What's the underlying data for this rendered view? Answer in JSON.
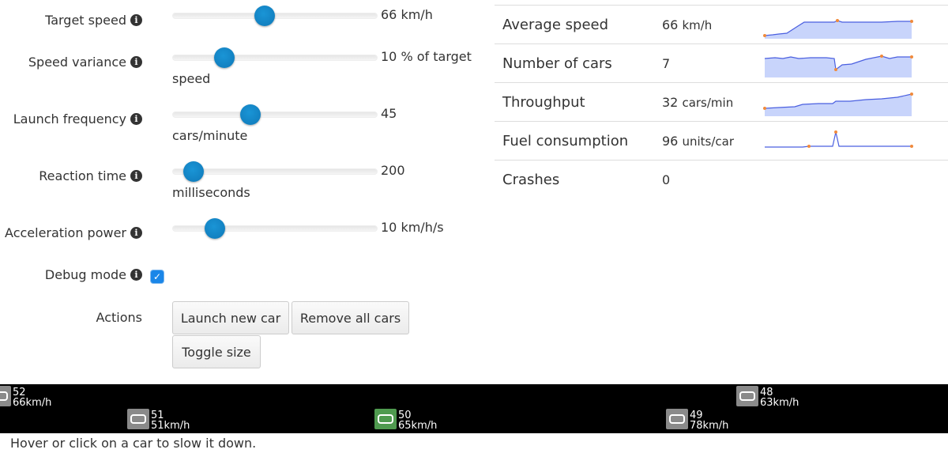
{
  "controls": {
    "target_speed": {
      "label": "Target speed",
      "value": "66 km/h",
      "level": 0.45
    },
    "speed_variance": {
      "label": "Speed variance",
      "value": "10 % of target",
      "unit": "speed",
      "level": 0.25
    },
    "launch_frequency": {
      "label": "Launch frequency",
      "value": "45",
      "unit": "cars/minute",
      "level": 0.38
    },
    "reaction_time": {
      "label": "Reaction time",
      "value": "200",
      "unit": "milliseconds",
      "level": 0.1
    },
    "acceleration_power": {
      "label": "Acceleration power",
      "value": "10 km/h/s",
      "level": 0.2
    },
    "debug_mode": {
      "label": "Debug mode",
      "checked": true
    },
    "actions": {
      "label": "Actions"
    }
  },
  "buttons": {
    "launch": "Launch new car",
    "remove": "Remove all cars",
    "toggle": "Toggle size"
  },
  "stats": [
    {
      "name": "Average speed",
      "value": "66",
      "unit": "km/h"
    },
    {
      "name": "Number of cars",
      "value": "7",
      "unit": ""
    },
    {
      "name": "Throughput",
      "value": "32",
      "unit": "cars/min"
    },
    {
      "name": "Fuel consumption",
      "value": "96",
      "unit": "units/car"
    },
    {
      "name": "Crashes",
      "value": "0",
      "unit": ""
    }
  ],
  "cars": [
    {
      "id": "52",
      "speed": "66km/h",
      "color": "#8a8a8a"
    },
    {
      "id": "51",
      "speed": "51km/h",
      "color": "#8a8a8a"
    },
    {
      "id": "50",
      "speed": "65km/h",
      "color": "#4f9a4f"
    },
    {
      "id": "49",
      "speed": "78km/h",
      "color": "#8a8a8a"
    },
    {
      "id": "48",
      "speed": "63km/h",
      "color": "#8a8a8a"
    }
  ],
  "hint": "Hover or click on a car to slow it down.",
  "colors": {
    "accent": "#1a86e8",
    "slider_knob": "#1389cb",
    "sparkline": "#4a5fe0",
    "sparkline_fill": "#c8d4fb",
    "spark_marker": "#f08a3c",
    "road": "#000000"
  }
}
